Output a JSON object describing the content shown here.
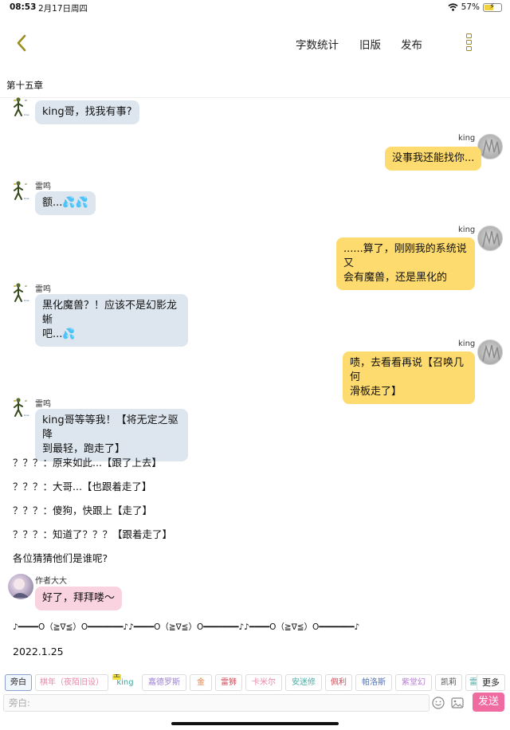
{
  "status": {
    "time": "08:53",
    "date": "2月17日周四",
    "battery": "57%",
    "battery_level": 0.57
  },
  "nav": {
    "stats_label": "字数统计",
    "old_label": "旧版",
    "publish_label": "发布"
  },
  "chapter": {
    "title": "第十五章"
  },
  "messages": [
    {
      "speaker": "",
      "text": "king哥，找我有事?"
    },
    {
      "speaker": "king",
      "text": "没事我还能找你..."
    },
    {
      "speaker": "雷鸣",
      "text": "额...💦💦"
    },
    {
      "speaker": "king",
      "text_line1": "......算了，刚刚我的系统说又",
      "text_line2": "会有魔兽，还是黑化的"
    },
    {
      "speaker": "雷鸣",
      "text_line1": "黑化魔兽？！应该不是幻影龙蜥",
      "text_line2": "吧...💦"
    },
    {
      "speaker": "king",
      "text_line1": "啧，去看看再说【召唤几何",
      "text_line2": "滑板走了】"
    },
    {
      "speaker": "雷鸣",
      "text_line1": "king哥等等我！【将无定之驱降",
      "text_line2": "到最轻，跑走了】"
    }
  ],
  "narration": [
    "？？？：原来如此...【跟了上去】",
    "？？？：大哥...【也跟着走了】",
    "？？？：傻狗，快跟上【走了】",
    "？？？：知道了？？？【跟着走了】",
    "各位猜猜他们是谁呢?"
  ],
  "author": {
    "name": "作者大大",
    "text": "好了，拜拜喽～"
  },
  "divider_line": "♪━━━━O（≧∇≦）O━━━━━━━♪♪━━━━O（≧∇≦）O━━━━━━━♪♪━━━━O（≧∇≦）O━━━━━━━♪",
  "date_line": "2022.1.25",
  "characters": [
    {
      "label": "旁白",
      "color": "#222222"
    },
    {
      "label": "棋年（夜陌旧设）",
      "color": "#e68aa8"
    },
    {
      "label": "king",
      "color": "#3aa8a0",
      "badge": "主"
    },
    {
      "label": "嘉德罗斯",
      "color": "#9b7fd1"
    },
    {
      "label": "金",
      "color": "#e07b3c"
    },
    {
      "label": "雷狮",
      "color": "#d04a58"
    },
    {
      "label": "卡米尔",
      "color": "#e68aa8"
    },
    {
      "label": "安迷修",
      "color": "#4aa9a3"
    },
    {
      "label": "佩利",
      "color": "#d04a58"
    },
    {
      "label": "帕洛斯",
      "color": "#4f6fb0"
    },
    {
      "label": "紫堂幻",
      "color": "#b47fd1"
    },
    {
      "label": "凯莉",
      "color": "#555555"
    },
    {
      "label": "雷",
      "color": "#4aa9a3"
    }
  ],
  "more_label": "更多",
  "input": {
    "placeholder": "旁白:"
  },
  "send_label": "发送"
}
